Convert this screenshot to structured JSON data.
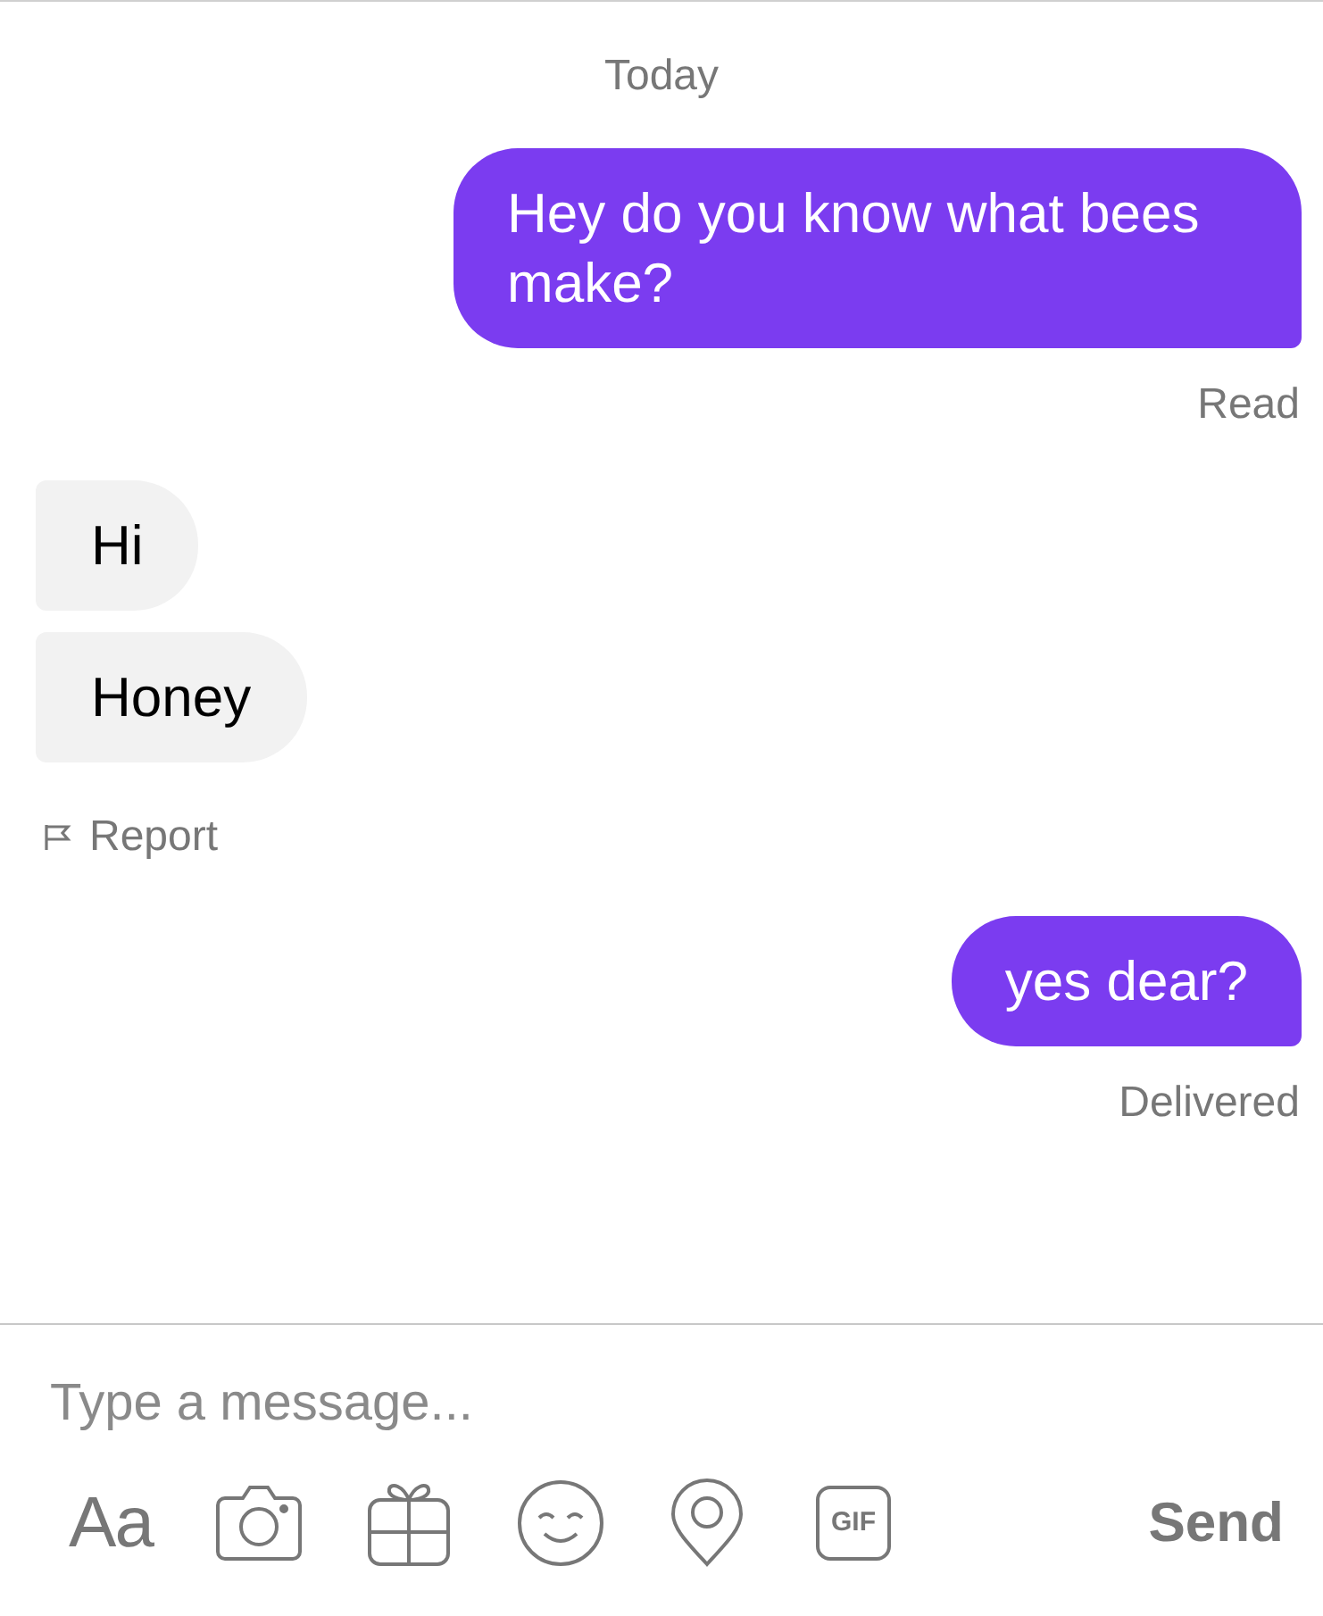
{
  "conversation": [
    {
      "kind": "date",
      "text": "Today"
    },
    {
      "kind": "sent",
      "text": "Hey do you know what bees make?"
    },
    {
      "kind": "status",
      "text": "Read"
    },
    {
      "kind": "received",
      "text": "Hi"
    },
    {
      "kind": "received",
      "text": "Honey"
    },
    {
      "kind": "report",
      "text": "Report"
    },
    {
      "kind": "sent",
      "text": "yes dear?"
    },
    {
      "kind": "status",
      "text": "Delivered"
    }
  ],
  "composer": {
    "placeholder": "Type a message...",
    "font_button": "Aa",
    "gif_button": "GIF",
    "send": "Send"
  }
}
